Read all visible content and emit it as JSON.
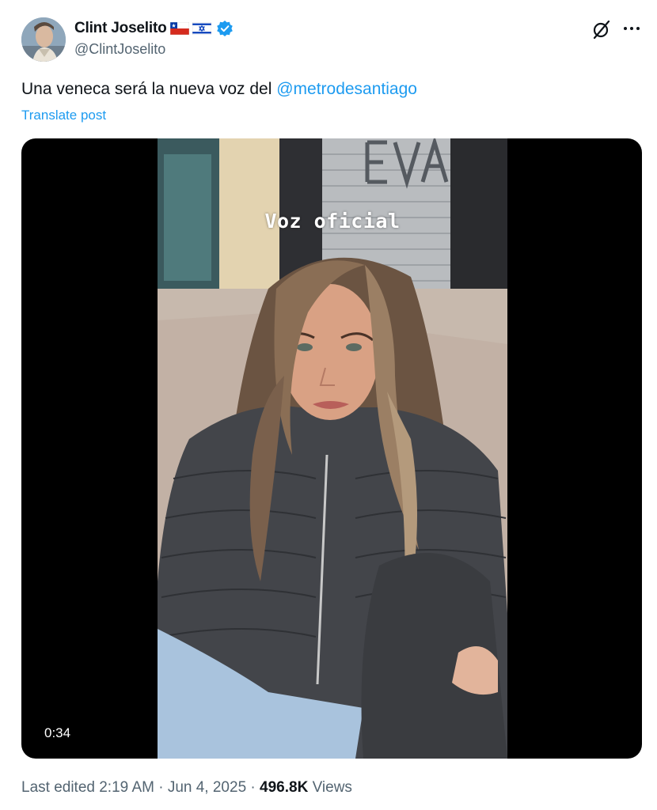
{
  "author": {
    "display_name": "Clint Joselito",
    "handle": "@ClintJoselito",
    "flags": [
      "chile-flag-icon",
      "israel-flag-icon"
    ],
    "verified": true
  },
  "tweet": {
    "text_prefix": "Una veneca será la nueva voz del ",
    "mention": "@metrodesantiago",
    "translate_label": "Translate post"
  },
  "video": {
    "overlay_text": "Voz oficial",
    "duration": "0:34"
  },
  "footer": {
    "edited_time": "Last edited 2:19 AM · Jun 4, 2025 · ",
    "views_count": "496.8K",
    "views_label": " Views"
  },
  "colors": {
    "link": "#1d9bf0",
    "secondary_text": "#536471",
    "primary_text": "#0f1419",
    "verified_badge": "#1d9bf0"
  },
  "icons": {
    "grok": "grok-slash-icon",
    "more": "more-dots-icon"
  }
}
